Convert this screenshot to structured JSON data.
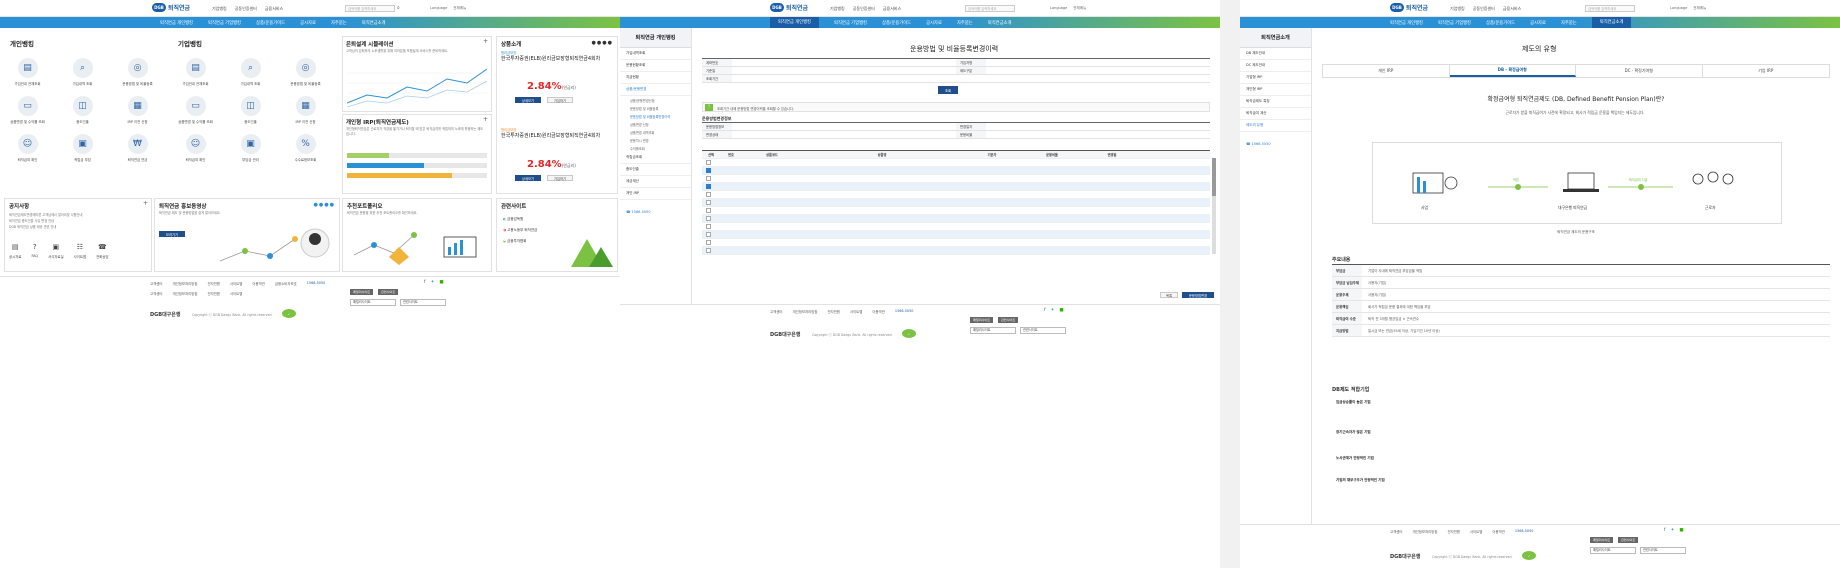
{
  "p1": {
    "logo": {
      "mark": "DGB",
      "title": "퇴직연금"
    },
    "top_links": [
      "기업뱅킹",
      "공동인증센터",
      "금융서비스"
    ],
    "search": {
      "placeholder": "검색어를 입력하세요"
    },
    "utils": [
      "Language",
      "전체메뉴"
    ],
    "gnb": [
      "퇴직연금 개인뱅킹",
      "퇴직연금 기업뱅킹",
      "상품/운용가이드",
      "공시자료",
      "자주묻는",
      "퇴직연금소개"
    ],
    "personal": {
      "title": "개인뱅킹",
      "items": [
        "가입안내 전체조회",
        "가입내역 조회",
        "운용방법 및 비율등록",
        "상품변경 및 수익률 조회",
        "중도인출",
        "IRP 이전 신청",
        "퇴직급여 확인",
        "적립금 부담",
        "퇴직연금 연금"
      ]
    },
    "corporate": {
      "title": "기업뱅킹",
      "items": [
        "가입안내 전체조회",
        "가입내역 조회",
        "운용방법 및 비율등록",
        "상품변경 및 수익률 조회",
        "중도인출",
        "IRP 이전 신청",
        "퇴직급여 확인",
        "부담금 관리",
        "수수료정보조회"
      ]
    },
    "simulation": {
      "title": "은퇴설계 시뮬레이션",
      "desc": "고객님의 은퇴후의 노후생활을 위해 여러분을 포함설계 서비스를 준비하세요."
    },
    "irp": {
      "title": "개인형 IRP(퇴직연금제도)",
      "desc": "개인형퇴직연금은 근로자가 직장을 옮기거나 퇴직할 때 받은 퇴직급여를 적립하여 노후에 활용하는 제도입니다."
    },
    "product": {
      "title": "상품소개",
      "badge1": "원리금보장",
      "name1": "한국투자증권(ELB)원리금보장형퇴직연금4회차",
      "rate1": "2.84%",
      "unit1": "(연금리)",
      "badge2": "원리금보장",
      "name2": "한국투자증권(ELB)원리금보장형퇴직연금4회차",
      "rate2": "2.84%",
      "unit2": "(연금리)",
      "btn_detail": "상세보기",
      "btn_join": "가입하기"
    },
    "notice": {
      "title": "공지사항",
      "lines": [
        "퇴직연금제도변경에따른 고객님께서 알아야할 사항안내",
        "퇴직연금 중도인출 사유 변경 안내",
        "DGB 퇴직연금 상품 제공 관련 안내"
      ],
      "quick": [
        "공시자료",
        "FAQ",
        "서식자료실",
        "사이트맵",
        "전화상담"
      ]
    },
    "promo": {
      "title": "퇴직연금 홍보동영상",
      "desc": "퇴직연금 제도 및 운용방법을 쉽게 알아보세요.",
      "btn": "보러가기"
    },
    "recommend": {
      "title": "추천포트폴리오",
      "desc": "퇴직연금 운용을 위한 추천 포트폴리오를 확인하세요."
    },
    "related": {
      "title": "관련사이트",
      "items": [
        "금융감독원",
        "고용노동부 퇴직연금",
        "금융투자협회"
      ]
    },
    "footer": {
      "links": [
        "고객센터",
        "개인정보처리방침",
        "전자민원",
        "사이트맵",
        "이용약관",
        "금융소비자보호"
      ],
      "phone": "1566-5050",
      "copy": "Copyright ⓒ DGB Daegu Bank. All rights reserved.",
      "brand": "DGB대구은행",
      "family": "패밀리사이트",
      "rel": "관련사이트"
    }
  },
  "p2": {
    "gnb": [
      "퇴직연금 개인뱅킹",
      "퇴직연금 기업뱅킹",
      "상품/운용가이드",
      "공시자료",
      "자주묻는",
      "퇴직연금소개"
    ],
    "lnb_title": "퇴직연금 개인뱅킹",
    "lnb": [
      "가입내역조회",
      "운용현황조회",
      "지급현황",
      "상품/운용변경",
      "적립금조회",
      "중도인출",
      "세금계산",
      "개인 IRP"
    ],
    "lnb_sub": [
      "상품/운용변경신청",
      "운용방법 및 비율등록",
      "운용방법 및 비율등록변경이력",
      "상품변경 신청",
      "상품변경 내역조회",
      "운용지시 변경",
      "수익률조회"
    ],
    "title": "운용방법 및 비율등록변경이력",
    "form": [
      [
        "계좌번호",
        "",
        "가입자명",
        ""
      ],
      [
        "기준일",
        "",
        "제도구분",
        ""
      ],
      [
        "조회기간",
        "",
        "",
        ""
      ]
    ],
    "search_btn": "조회",
    "notice": "조회기간 내에 운용방법 변경이력을 조회할 수 있습니다.",
    "detail_title": "운용방법변경정보",
    "detail": [
      [
        "운용방법정보",
        "",
        "변경일자",
        ""
      ],
      [
        "변경상태",
        "",
        "운용비율",
        ""
      ]
    ],
    "table_headers": [
      "선택",
      "번호",
      "상품코드",
      "상품명",
      "기준가",
      "운용비율",
      "변경일"
    ],
    "btn_list": "목록",
    "btn_save": "운용방법변경"
  },
  "p3": {
    "gnb": [
      "퇴직연금 개인뱅킹",
      "퇴직연금 기업뱅킹",
      "상품/운용가이드",
      "공시자료",
      "자주묻는",
      "퇴직연금소개"
    ],
    "lnb_title": "퇴직연금소개",
    "lnb": [
      "DB 제도안내",
      "DC 제도안내",
      "기업형 IRP",
      "개인형 IRP",
      "퇴직금제도 특징",
      "퇴직급여 계산",
      "제도의 유형"
    ],
    "title": "제도의 유형",
    "tabs": [
      "개인 IRP",
      "DB - 확정급여형",
      "DC - 확정기여형",
      "기업 IRP"
    ],
    "heading": "확정급여형 퇴직연금제도 (DB, Defined Benefit Pension Plan)란?",
    "desc": "근로자가 받을 퇴직급여가 사전에 확정되고, 회사가 적립금 운용을 책임지는 제도입니다.",
    "flow": [
      "사업",
      "대구은행 퇴직연금",
      "근로자"
    ],
    "flow_labels": [
      "적립",
      "퇴직급여 지급"
    ],
    "flow_note": "퇴직연금 제도의 운용구조",
    "main_title": "주요내용",
    "rows": [
      [
        "부담금",
        "기업이 사내에 퇴직연금 부담금을 적립"
      ],
      [
        "부담금 납입주체",
        "사용자(기업)"
      ],
      [
        "운용주체",
        "사용자(기업)"
      ],
      [
        "운용책임",
        "회사가 적립금 운용 결과에 대한 책임을 부담"
      ],
      [
        "퇴직급여 수준",
        "퇴직 전 3개월 평균임금 × 근속연수"
      ],
      [
        "지급방법",
        "일시금 또는 연금(55세 이상, 가입기간 10년 이상)"
      ]
    ],
    "fit_title": "DB제도 적합기업",
    "fit": [
      "임금상승률이 높은 기업",
      "장기근속자가 많은 기업",
      "노사관계가 안정적인 기업",
      "기업의 재무구조가 안정적인 기업"
    ]
  }
}
